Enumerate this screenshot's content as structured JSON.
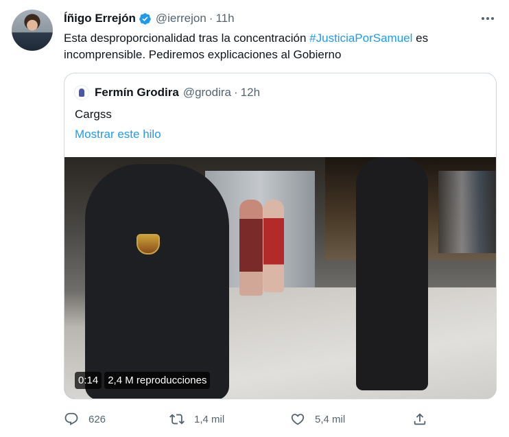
{
  "tweet": {
    "author_name": "Íñigo Errejón",
    "handle": "@ierrejon",
    "separator": "·",
    "time": "11h",
    "text_part1": "Esta desproporcionalidad tras la concentración ",
    "hashtag": "#JusticiaPorSamuel",
    "text_part2": " es incomprensible. Pediremos explicaciones al Gobierno"
  },
  "quote": {
    "author_name": "Fermín Grodira",
    "handle": "@grodira",
    "separator": "·",
    "time": "12h",
    "text": "Cargss",
    "show_thread": "Mostrar este hilo",
    "video": {
      "duration": "0:14",
      "views": "2,4 M reproducciones"
    }
  },
  "actions": {
    "replies": "626",
    "retweets": "1,4 mil",
    "likes": "5,4 mil"
  },
  "colors": {
    "accent": "#1d9bf0",
    "secondary_text": "#536471",
    "border": "#cfd9de"
  }
}
